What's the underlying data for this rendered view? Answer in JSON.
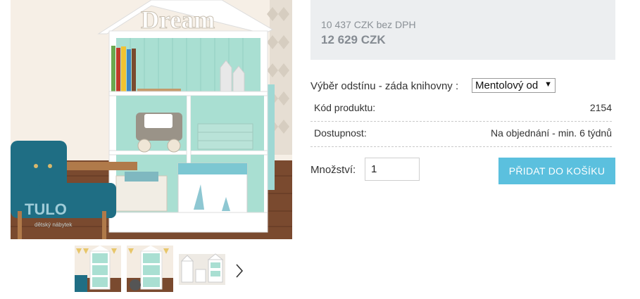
{
  "gallery": {
    "main_alt": "Knihovna domeček Dream",
    "main_sign_text": "Dream",
    "watermark_logo": "TULO",
    "watermark_sub": "dětský nábytek",
    "next_icon": "chevron-right-icon",
    "thumbnails": [
      "thumb-1",
      "thumb-2",
      "thumb-3"
    ]
  },
  "price": {
    "nett": "10 437 CZK bez DPH",
    "gross": "12 629 CZK"
  },
  "variant": {
    "label": "Výběr odstínu - záda knihovny :",
    "selected": "Mentolový od"
  },
  "specs": [
    {
      "label": "Kód produktu:",
      "value": "2154"
    },
    {
      "label": "Dostupnost:",
      "value": "Na objednání - min. 6 týdnů"
    }
  ],
  "cart": {
    "qty_label": "Množství:",
    "qty_value": "1",
    "add_label": "PŘIDAT DO KOŠÍKU"
  },
  "colors": {
    "accent": "#5bc0de",
    "mint": "#a9dfd2",
    "price_box": "#eceef0",
    "chair": "#1f6e84"
  }
}
